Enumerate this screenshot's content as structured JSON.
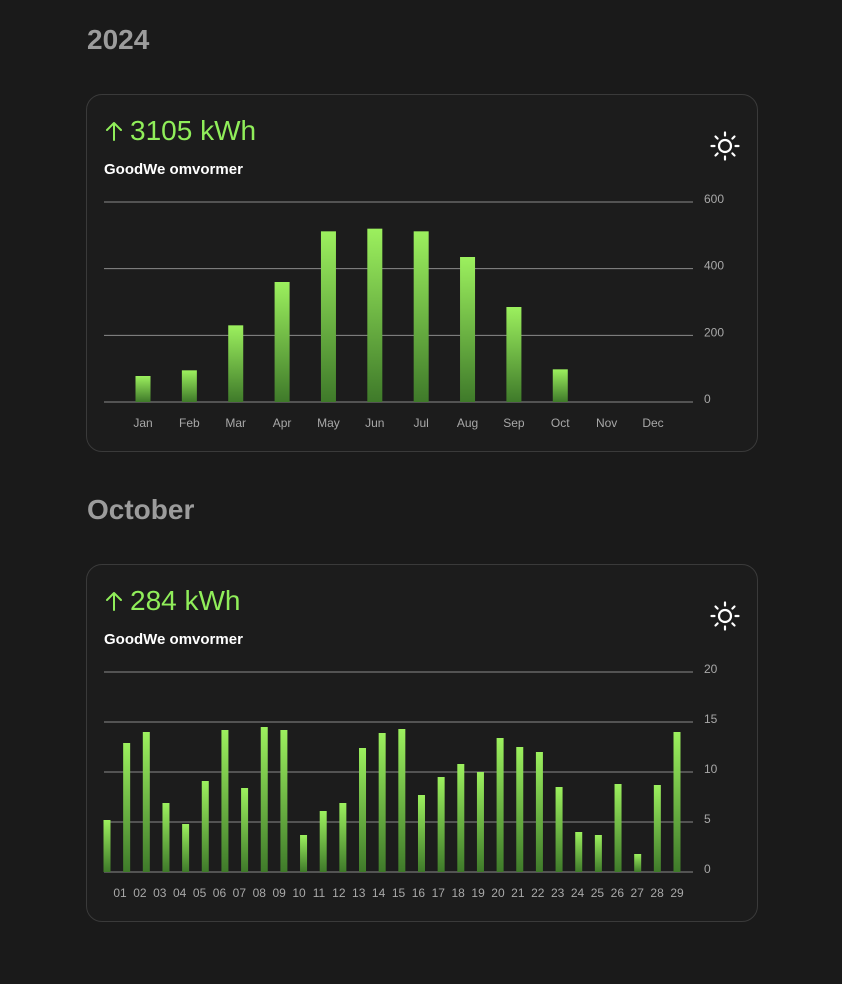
{
  "sections": [
    {
      "title": "2024",
      "card": {
        "total_value": "3105 kWh",
        "device_name": "GoodWe omvormer",
        "trend_icon": "arrow-up-icon",
        "weather_icon": "sun-icon"
      }
    },
    {
      "title": "October",
      "card": {
        "total_value": "284 kWh",
        "device_name": "GoodWe omvormer",
        "trend_icon": "arrow-up-icon",
        "weather_icon": "sun-icon"
      }
    }
  ],
  "colors": {
    "accent": "#90ee5a",
    "bar_top": "#9cf05e",
    "bar_bottom": "#3f7a2a",
    "background": "#1a1a1a",
    "card_border": "#3a3a3a"
  },
  "chart_data": [
    {
      "type": "bar",
      "categories": [
        "Jan",
        "Feb",
        "Mar",
        "Apr",
        "May",
        "Jun",
        "Jul",
        "Aug",
        "Sep",
        "Oct",
        "Nov",
        "Dec"
      ],
      "values": [
        78,
        95,
        230,
        360,
        512,
        520,
        512,
        435,
        285,
        98,
        0,
        0
      ],
      "yticks": [
        "0",
        "200",
        "400",
        "600"
      ],
      "ylim": [
        0,
        600
      ],
      "grid": true
    },
    {
      "type": "bar",
      "categories": [
        "01",
        "02",
        "03",
        "04",
        "05",
        "06",
        "07",
        "08",
        "09",
        "10",
        "11",
        "12",
        "13",
        "14",
        "15",
        "16",
        "17",
        "18",
        "19",
        "20",
        "21",
        "22",
        "23",
        "24",
        "25",
        "26",
        "27",
        "28",
        "29"
      ],
      "values": [
        5.2,
        12.9,
        14.0,
        6.9,
        4.8,
        9.1,
        14.2,
        8.4,
        14.5,
        14.2,
        3.7,
        6.1,
        6.9,
        12.4,
        13.9,
        14.3,
        7.7,
        9.5,
        10.8,
        10.0,
        13.4,
        12.5,
        12.0,
        8.5,
        4.0,
        3.7,
        8.8,
        1.8,
        8.7,
        14.0
      ],
      "yticks": [
        "0",
        "5",
        "10",
        "15",
        "20"
      ],
      "ylim": [
        0,
        20
      ],
      "grid": true
    }
  ]
}
